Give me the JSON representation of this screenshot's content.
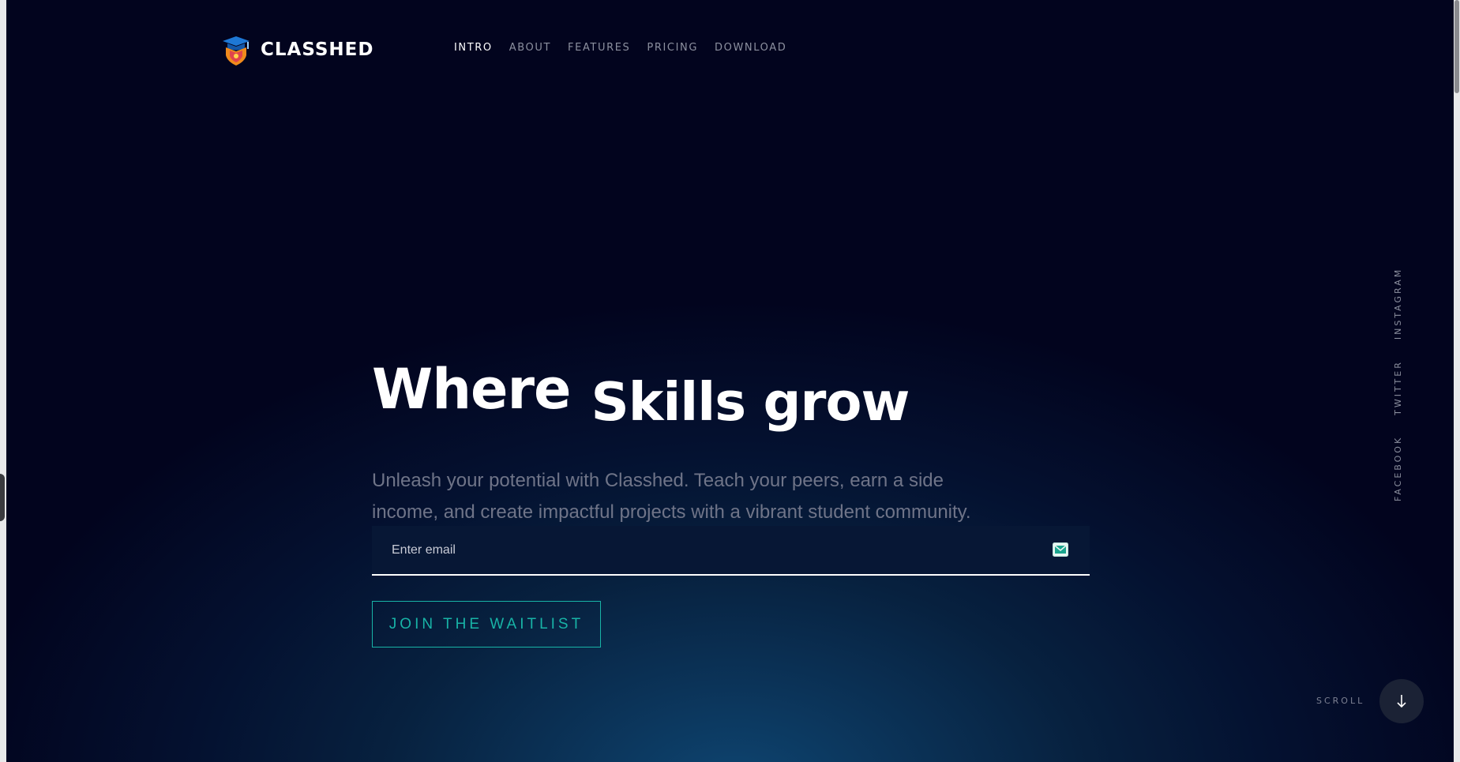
{
  "brand": {
    "name": "CLASSHED",
    "logo_icon": "graduation-shield-icon"
  },
  "nav": {
    "items": [
      {
        "label": "INTRO",
        "active": true
      },
      {
        "label": "ABOUT",
        "active": false
      },
      {
        "label": "FEATURES",
        "active": false
      },
      {
        "label": "PRICING",
        "active": false
      },
      {
        "label": "DOWNLOAD",
        "active": false
      }
    ]
  },
  "hero": {
    "headline_word1": "Where",
    "headline_word2": "Skills grow",
    "lead": "Unleash your potential with Classhed. Teach your peers, earn a side income, and create impactful projects with a vibrant student community."
  },
  "email": {
    "placeholder": "Enter email",
    "value": "",
    "icon": "mail-icon"
  },
  "cta": {
    "label": "JOIN THE WAITLIST"
  },
  "social": {
    "items": [
      "FACEBOOK",
      "TWITTER",
      "INSTAGRAM"
    ]
  },
  "scroll": {
    "label": "SCROLL",
    "icon": "arrow-down-icon"
  },
  "colors": {
    "background": "#02041e",
    "glow": "#0e4571",
    "accent": "#18b3a6",
    "muted_text": "#6f7488"
  }
}
